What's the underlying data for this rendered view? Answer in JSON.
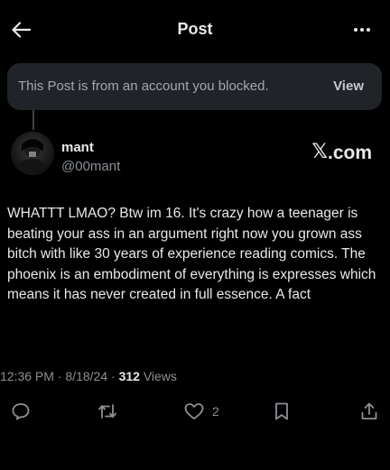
{
  "header": {
    "title": "Post",
    "back_icon": "arrow-left-icon",
    "more_icon": "more-horizontal-icon"
  },
  "blocked_notice": {
    "text": "This Post is from an account you blocked.",
    "view_label": "View"
  },
  "author": {
    "display_name": "mant",
    "handle": "@00mant"
  },
  "watermark": {
    "logo": "𝕏",
    "text": ".com"
  },
  "post": {
    "text": "WHATTT LMAO? Btw im 16. It's crazy how a teenager is beating your ass in an argument right now you grown ass bitch with like 30 years of experience reading comics. The phoenix is an embodiment of everything is expresses which means it has never created in full essence. A fact"
  },
  "meta": {
    "time": "12:36 PM",
    "separator": "·",
    "date": "8/18/24",
    "views_count": "312",
    "views_label": "Views"
  },
  "actions": {
    "reply_icon": "reply-icon",
    "repost_icon": "repost-icon",
    "like_icon": "heart-icon",
    "like_count": "2",
    "bookmark_icon": "bookmark-icon",
    "share_icon": "share-icon"
  },
  "colors": {
    "background": "#000000",
    "text_primary": "#e7e9ea",
    "text_secondary": "#8b9096",
    "banner_bg": "#202327"
  }
}
